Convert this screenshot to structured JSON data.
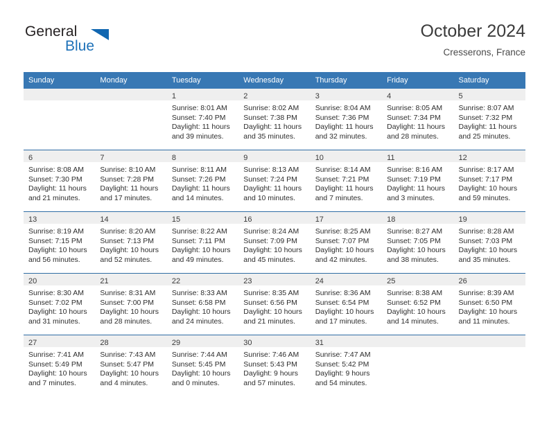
{
  "brand": {
    "name_part1": "General",
    "name_part2": "Blue",
    "triangle_color": "#1167b1",
    "blue_color": "#1d71b8"
  },
  "header": {
    "title": "October 2024",
    "subtitle": "Cresserons, France"
  },
  "theme": {
    "header_blue": "#3878b4",
    "row_divider": "#2e6ca4",
    "day_band": "#efefef",
    "text": "#2d2d2d"
  },
  "weekdays": [
    "Sunday",
    "Monday",
    "Tuesday",
    "Wednesday",
    "Thursday",
    "Friday",
    "Saturday"
  ],
  "weeks": [
    [
      {
        "date": "",
        "lines": []
      },
      {
        "date": "",
        "lines": []
      },
      {
        "date": "1",
        "lines": [
          "Sunrise: 8:01 AM",
          "Sunset: 7:40 PM",
          "Daylight: 11 hours",
          "and 39 minutes."
        ]
      },
      {
        "date": "2",
        "lines": [
          "Sunrise: 8:02 AM",
          "Sunset: 7:38 PM",
          "Daylight: 11 hours",
          "and 35 minutes."
        ]
      },
      {
        "date": "3",
        "lines": [
          "Sunrise: 8:04 AM",
          "Sunset: 7:36 PM",
          "Daylight: 11 hours",
          "and 32 minutes."
        ]
      },
      {
        "date": "4",
        "lines": [
          "Sunrise: 8:05 AM",
          "Sunset: 7:34 PM",
          "Daylight: 11 hours",
          "and 28 minutes."
        ]
      },
      {
        "date": "5",
        "lines": [
          "Sunrise: 8:07 AM",
          "Sunset: 7:32 PM",
          "Daylight: 11 hours",
          "and 25 minutes."
        ]
      }
    ],
    [
      {
        "date": "6",
        "lines": [
          "Sunrise: 8:08 AM",
          "Sunset: 7:30 PM",
          "Daylight: 11 hours",
          "and 21 minutes."
        ]
      },
      {
        "date": "7",
        "lines": [
          "Sunrise: 8:10 AM",
          "Sunset: 7:28 PM",
          "Daylight: 11 hours",
          "and 17 minutes."
        ]
      },
      {
        "date": "8",
        "lines": [
          "Sunrise: 8:11 AM",
          "Sunset: 7:26 PM",
          "Daylight: 11 hours",
          "and 14 minutes."
        ]
      },
      {
        "date": "9",
        "lines": [
          "Sunrise: 8:13 AM",
          "Sunset: 7:24 PM",
          "Daylight: 11 hours",
          "and 10 minutes."
        ]
      },
      {
        "date": "10",
        "lines": [
          "Sunrise: 8:14 AM",
          "Sunset: 7:21 PM",
          "Daylight: 11 hours",
          "and 7 minutes."
        ]
      },
      {
        "date": "11",
        "lines": [
          "Sunrise: 8:16 AM",
          "Sunset: 7:19 PM",
          "Daylight: 11 hours",
          "and 3 minutes."
        ]
      },
      {
        "date": "12",
        "lines": [
          "Sunrise: 8:17 AM",
          "Sunset: 7:17 PM",
          "Daylight: 10 hours",
          "and 59 minutes."
        ]
      }
    ],
    [
      {
        "date": "13",
        "lines": [
          "Sunrise: 8:19 AM",
          "Sunset: 7:15 PM",
          "Daylight: 10 hours",
          "and 56 minutes."
        ]
      },
      {
        "date": "14",
        "lines": [
          "Sunrise: 8:20 AM",
          "Sunset: 7:13 PM",
          "Daylight: 10 hours",
          "and 52 minutes."
        ]
      },
      {
        "date": "15",
        "lines": [
          "Sunrise: 8:22 AM",
          "Sunset: 7:11 PM",
          "Daylight: 10 hours",
          "and 49 minutes."
        ]
      },
      {
        "date": "16",
        "lines": [
          "Sunrise: 8:24 AM",
          "Sunset: 7:09 PM",
          "Daylight: 10 hours",
          "and 45 minutes."
        ]
      },
      {
        "date": "17",
        "lines": [
          "Sunrise: 8:25 AM",
          "Sunset: 7:07 PM",
          "Daylight: 10 hours",
          "and 42 minutes."
        ]
      },
      {
        "date": "18",
        "lines": [
          "Sunrise: 8:27 AM",
          "Sunset: 7:05 PM",
          "Daylight: 10 hours",
          "and 38 minutes."
        ]
      },
      {
        "date": "19",
        "lines": [
          "Sunrise: 8:28 AM",
          "Sunset: 7:03 PM",
          "Daylight: 10 hours",
          "and 35 minutes."
        ]
      }
    ],
    [
      {
        "date": "20",
        "lines": [
          "Sunrise: 8:30 AM",
          "Sunset: 7:02 PM",
          "Daylight: 10 hours",
          "and 31 minutes."
        ]
      },
      {
        "date": "21",
        "lines": [
          "Sunrise: 8:31 AM",
          "Sunset: 7:00 PM",
          "Daylight: 10 hours",
          "and 28 minutes."
        ]
      },
      {
        "date": "22",
        "lines": [
          "Sunrise: 8:33 AM",
          "Sunset: 6:58 PM",
          "Daylight: 10 hours",
          "and 24 minutes."
        ]
      },
      {
        "date": "23",
        "lines": [
          "Sunrise: 8:35 AM",
          "Sunset: 6:56 PM",
          "Daylight: 10 hours",
          "and 21 minutes."
        ]
      },
      {
        "date": "24",
        "lines": [
          "Sunrise: 8:36 AM",
          "Sunset: 6:54 PM",
          "Daylight: 10 hours",
          "and 17 minutes."
        ]
      },
      {
        "date": "25",
        "lines": [
          "Sunrise: 8:38 AM",
          "Sunset: 6:52 PM",
          "Daylight: 10 hours",
          "and 14 minutes."
        ]
      },
      {
        "date": "26",
        "lines": [
          "Sunrise: 8:39 AM",
          "Sunset: 6:50 PM",
          "Daylight: 10 hours",
          "and 11 minutes."
        ]
      }
    ],
    [
      {
        "date": "27",
        "lines": [
          "Sunrise: 7:41 AM",
          "Sunset: 5:49 PM",
          "Daylight: 10 hours",
          "and 7 minutes."
        ]
      },
      {
        "date": "28",
        "lines": [
          "Sunrise: 7:43 AM",
          "Sunset: 5:47 PM",
          "Daylight: 10 hours",
          "and 4 minutes."
        ]
      },
      {
        "date": "29",
        "lines": [
          "Sunrise: 7:44 AM",
          "Sunset: 5:45 PM",
          "Daylight: 10 hours",
          "and 0 minutes."
        ]
      },
      {
        "date": "30",
        "lines": [
          "Sunrise: 7:46 AM",
          "Sunset: 5:43 PM",
          "Daylight: 9 hours",
          "and 57 minutes."
        ]
      },
      {
        "date": "31",
        "lines": [
          "Sunrise: 7:47 AM",
          "Sunset: 5:42 PM",
          "Daylight: 9 hours",
          "and 54 minutes."
        ]
      },
      {
        "date": "",
        "lines": []
      },
      {
        "date": "",
        "lines": []
      }
    ]
  ]
}
